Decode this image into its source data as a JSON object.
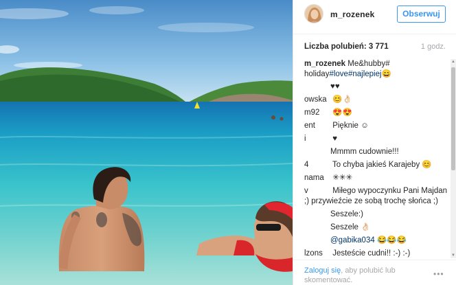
{
  "post": {
    "username": "m_rozenek",
    "follow_label": "Obserwuj",
    "likes_label": "Liczba polubień: 3 771",
    "time_ago": "1 godz.",
    "caption_user": "m_rozenek",
    "caption_text_1": " Me&hubby#",
    "caption_text_2": "holiday",
    "caption_tag_1": "#love",
    "caption_tag_2": "#najlepiej",
    "caption_emoji": "😄"
  },
  "comments": [
    {
      "user": "",
      "text": "♥♥"
    },
    {
      "user": "owska",
      "text": " 😊👌🏻"
    },
    {
      "user": "m92",
      "text": " 😍😍"
    },
    {
      "user": "ent",
      "text": " Pięknie ☺"
    },
    {
      "user": "i",
      "text": " ♥"
    },
    {
      "user": "",
      "text": "Mmmm cudownie!!!"
    },
    {
      "user": "4",
      "text": " To chyba jakieś Karajeby 😊"
    },
    {
      "user": "nama",
      "text": " ✳✳✳"
    },
    {
      "user": "v",
      "text": " Miłego wypoczynku Pani Majdan ;) przywieźcie ze sobą trochę słońca ;)"
    },
    {
      "user": "",
      "text": "Seszele:)"
    },
    {
      "user": "",
      "text": "Seszele 👌🏻"
    },
    {
      "user": "",
      "text": "@gabika034 😂😂😂"
    },
    {
      "user": "lzons",
      "text": " Jesteście cudni!! :-) :-)"
    }
  ],
  "footer": {
    "login_link": "Zaloguj się",
    "login_text": ", aby polubić lub skomentować.",
    "more_label": "•••"
  },
  "colors": {
    "accent": "#3897f0",
    "hashtag": "#003569",
    "muted": "#a5a7aa",
    "sky": "#4a90c8",
    "sea": "#2fb8c4"
  }
}
